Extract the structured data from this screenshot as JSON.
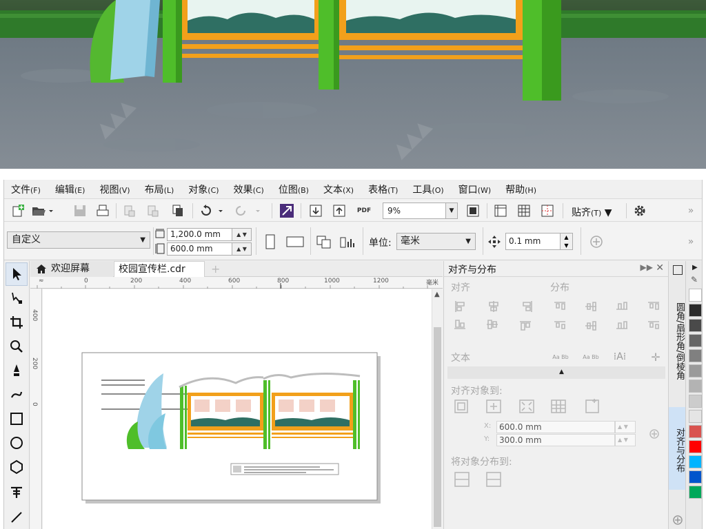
{
  "menu": {
    "items": [
      {
        "label": "文件",
        "accel": "(F)"
      },
      {
        "label": "编辑",
        "accel": "(E)"
      },
      {
        "label": "视图",
        "accel": "(V)"
      },
      {
        "label": "布局",
        "accel": "(L)"
      },
      {
        "label": "对象",
        "accel": "(C)"
      },
      {
        "label": "效果",
        "accel": "(C)"
      },
      {
        "label": "位图",
        "accel": "(B)"
      },
      {
        "label": "文本",
        "accel": "(X)"
      },
      {
        "label": "表格",
        "accel": "(T)"
      },
      {
        "label": "工具",
        "accel": "(O)"
      },
      {
        "label": "窗口",
        "accel": "(W)"
      },
      {
        "label": "帮助",
        "accel": "(H)"
      }
    ]
  },
  "standard_toolbar": {
    "pdf_label": "PDF",
    "zoom_value": "9%",
    "snap_label": "贴齐",
    "snap_accel": "(T)"
  },
  "property_bar": {
    "page_preset": "自定义",
    "width": "1,200.0 mm",
    "height": "600.0 mm",
    "units_label": "单位:",
    "units_value": "毫米",
    "nudge": "0.1 mm"
  },
  "tabs": {
    "welcome": "欢迎屏幕",
    "document": "校园宣传栏.cdr",
    "add": "+"
  },
  "ruler": {
    "top_marks": [
      "0",
      "200",
      "400",
      "600",
      "800",
      "1000",
      "1200"
    ],
    "unit": "毫米",
    "left_marks": [
      "400",
      "200",
      "0"
    ]
  },
  "docker": {
    "title": "对齐与分布",
    "align_label": "对齐",
    "distribute_label": "分布",
    "text_label": "文本",
    "text_icons": [
      "Aa Bb",
      "Aa Bb",
      "Aa Bb"
    ],
    "align_to_label": "对齐对象到:",
    "x_label": "X:",
    "x_value": "600.0 mm",
    "y_label": "Y:",
    "y_value": "300.0 mm",
    "distribute_to_label": "将对象分布到:"
  },
  "side_tabs": {
    "fillet": "圆角/扇形角/倒棱角",
    "align": "对齐与分布"
  },
  "palette": {
    "colors": [
      "#ffffff",
      "#2b2b2b",
      "#4a4a4a",
      "#666666",
      "#808080",
      "#9a9a9a",
      "#b3b3b3",
      "#cccccc",
      "#e5e5e5",
      "#d9534f",
      "#ff0000",
      "#00b4ff",
      "#0055cc",
      "#00a85a"
    ]
  },
  "colors": {
    "brand_green": "#4fbe2a",
    "brand_orange": "#f2a01b",
    "light_blue": "#9fd3e8"
  }
}
